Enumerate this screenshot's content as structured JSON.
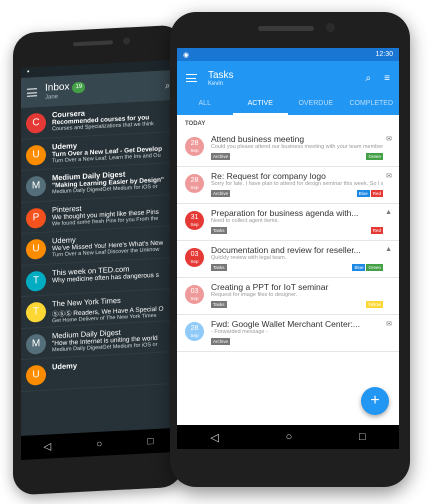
{
  "inbox": {
    "title": "Inbox",
    "badge": "19",
    "account": "Jane",
    "mails": [
      {
        "initial": "C",
        "color": "#e53935",
        "from": "Coursera",
        "subject": "Recommended courses for you",
        "preview": "Courses and Specializations that we think",
        "read": false
      },
      {
        "initial": "U",
        "color": "#fb8c00",
        "from": "Udemy",
        "subject": "Turn Over a New Leaf - Get Develop",
        "preview": "Turn Over a New Leaf: Learn the Ins and Ou",
        "read": false
      },
      {
        "initial": "M",
        "color": "#546e7a",
        "from": "Medium Daily Digest",
        "subject": "\"Making Learning Easier by Design\"",
        "preview": "Medium Daily DigestGet Medium for iOS or",
        "read": false
      },
      {
        "initial": "P",
        "color": "#f4511e",
        "from": "Pinterest",
        "subject": "We thought you might like these Pins",
        "preview": "We found some fresh Pins for you From the",
        "read": true
      },
      {
        "initial": "U",
        "color": "#fb8c00",
        "from": "Udemy",
        "subject": "We've Missed You! Here's What's New",
        "preview": "Turn Over a New Leaf Discover the Unknow",
        "read": true
      },
      {
        "initial": "T",
        "color": "#00acc1",
        "from": "This week on TED.com",
        "subject": "Why medicine often has dangerous s",
        "preview": "",
        "read": true
      },
      {
        "initial": "T",
        "color": "#fdd835",
        "from": "The New York Times",
        "subject": "ⓈⓈⓈ Readers, We Have A Special O",
        "preview": "Get Home Delivery of The New York Times",
        "read": true
      },
      {
        "initial": "M",
        "color": "#546e7a",
        "from": "Medium Daily Digest",
        "subject": "\"How the Internet is uniting the world",
        "preview": "Medium Daily DigestGet Medium for iOS or",
        "read": true
      },
      {
        "initial": "U",
        "color": "#fb8c00",
        "from": "Udemy",
        "subject": "",
        "preview": "",
        "read": false
      }
    ]
  },
  "tasks": {
    "status_time": "12:30",
    "title": "Tasks",
    "account": "Kevin",
    "tabs": [
      "ALL",
      "ACTIVE",
      "OVERDUE",
      "COMPLETED"
    ],
    "active_tab": 1,
    "section": "TODAY",
    "items": [
      {
        "day": "28",
        "mon": "Sep",
        "due_color": "#ef9a9a",
        "title": "Attend business meeting",
        "desc": "Could you please attend our business meeting with your team members? I would like to discuss main issues about how to ap...",
        "tag": "Archive",
        "labels": [
          {
            "text": "Green",
            "color": "#43a047"
          }
        ],
        "icon": "✉"
      },
      {
        "day": "28",
        "mon": "Sep",
        "due_color": "#ef9a9a",
        "title": "Re: Request for company logo",
        "desc": "Sorry for late. I have plan to attend for design seminar this week. So I will be able to send a company logo for you within next Mon...",
        "tag": "Archive",
        "labels": [
          {
            "text": "Blue",
            "color": "#1e88e5"
          },
          {
            "text": "Red",
            "color": "#e53935"
          }
        ],
        "icon": "✉"
      },
      {
        "day": "31",
        "mon": "Sep",
        "due_color": "#e53935",
        "title": "Preparation for business agenda with...",
        "desc": "Need to collect agent items.",
        "tag": "Tasks",
        "labels": [
          {
            "text": "Red",
            "color": "#e53935"
          }
        ],
        "icon": "▲"
      },
      {
        "day": "03",
        "mon": "Sep",
        "due_color": "#e53935",
        "title": "Documentation and review for reseller...",
        "desc": "Quickly review with legal team.",
        "tag": "Tasks",
        "labels": [
          {
            "text": "Blue",
            "color": "#1e88e5"
          },
          {
            "text": "Green",
            "color": "#43a047"
          }
        ],
        "icon": "▲"
      },
      {
        "day": "03",
        "mon": "Sep",
        "due_color": "#ef9a9a",
        "title": "Creating a PPT for IoT seminar",
        "desc": "Request for image files to designer.",
        "tag": "Tasks",
        "labels": [
          {
            "text": "Yellow",
            "color": "#fdd835"
          }
        ],
        "icon": ""
      },
      {
        "day": "28",
        "mon": "Sep",
        "due_color": "#90caf9",
        "title": "Fwd: Google Wallet Merchant Center:...",
        "desc": "- Forwarded message -",
        "tag": "Archive",
        "labels": [],
        "icon": "✉"
      }
    ]
  },
  "nav": {
    "back": "◁",
    "home": "○",
    "recent": "□"
  },
  "fab_label": "+"
}
